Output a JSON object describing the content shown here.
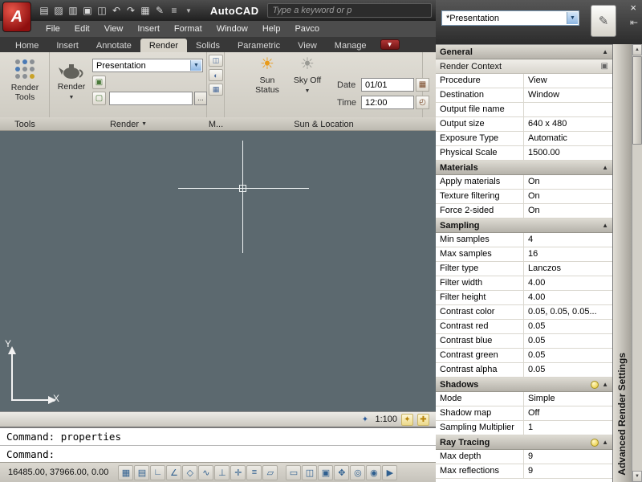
{
  "title_bar": {
    "app_name": "AutoCAD",
    "search_value": "Type a keyword or p",
    "qat_icons": [
      "new",
      "open",
      "save",
      "plot",
      "plot-preview",
      "undo",
      "redo",
      "publish",
      "markup",
      "properties"
    ]
  },
  "menu_bar": {
    "items": [
      "File",
      "Edit",
      "View",
      "Insert",
      "Format",
      "Window",
      "Help",
      "Pavco"
    ]
  },
  "ribbon": {
    "tabs": [
      {
        "label": "Home",
        "active": false
      },
      {
        "label": "Insert",
        "active": false
      },
      {
        "label": "Annotate",
        "active": false
      },
      {
        "label": "Render",
        "active": true
      },
      {
        "label": "Solids",
        "active": false
      },
      {
        "label": "Parametric",
        "active": false
      },
      {
        "label": "View",
        "active": false
      },
      {
        "label": "Manage",
        "active": false
      }
    ],
    "tools_panel": {
      "label": "Tools",
      "button_label": "Render Tools"
    },
    "render_panel": {
      "label": "Render",
      "button_label": "Render",
      "preset_value": "Presentation",
      "browse_label": "...",
      "output_file_value": ""
    },
    "materials_panel": {
      "label": "M...",
      "icons": [
        "materials-browser",
        "materials-editor",
        "planar-mapping"
      ]
    },
    "sun_panel": {
      "label": "Sun & Location",
      "sun_button": "Sun Status",
      "sky_button": "Sky Off",
      "date_label": "Date",
      "date_value": "01/01",
      "time_label": "Time",
      "time_value": "12:00"
    }
  },
  "drawing_area": {
    "ucs_x_label": "X",
    "ucs_y_label": "Y"
  },
  "scale_bar": {
    "annotation_scale": "1:100"
  },
  "command_line": {
    "line1": "Command: properties",
    "line2": "Command:"
  },
  "status_bar": {
    "coordinates": "16485.00, 37966.00, 0.00",
    "left_icons": [
      "snap",
      "grid",
      "ortho",
      "polar",
      "osnap",
      "otrack",
      "ducs",
      "dyn",
      "lwt",
      "qp"
    ],
    "right_icons": [
      "model",
      "quick-view-drawings",
      "quick-view-layouts",
      "pan",
      "zoom",
      "steering-wheel",
      "show-motion"
    ]
  },
  "palette": {
    "title": "Advanced Render Settings",
    "preset_value": "*Presentation",
    "rows": [
      {
        "type": "section",
        "label": "General",
        "bulb": false
      },
      {
        "type": "subsection",
        "label": "Render Context"
      },
      {
        "type": "row",
        "label": "Procedure",
        "value": "View"
      },
      {
        "type": "row",
        "label": "Destination",
        "value": "Window"
      },
      {
        "type": "row",
        "label": "Output file name",
        "value": ""
      },
      {
        "type": "row",
        "label": "Output size",
        "value": "640 x 480"
      },
      {
        "type": "row",
        "label": "Exposure Type",
        "value": "Automatic"
      },
      {
        "type": "row",
        "label": "Physical Scale",
        "value": "1500.00"
      },
      {
        "type": "section",
        "label": "Materials",
        "bulb": false
      },
      {
        "type": "row",
        "label": "Apply materials",
        "value": "On"
      },
      {
        "type": "row",
        "label": "Texture filtering",
        "value": "On"
      },
      {
        "type": "row",
        "label": "Force 2-sided",
        "value": "On"
      },
      {
        "type": "section",
        "label": "Sampling",
        "bulb": false
      },
      {
        "type": "row",
        "label": "Min samples",
        "value": "4"
      },
      {
        "type": "row",
        "label": "Max samples",
        "value": "16"
      },
      {
        "type": "row",
        "label": "Filter type",
        "value": "Lanczos"
      },
      {
        "type": "row",
        "label": "Filter width",
        "value": "4.00"
      },
      {
        "type": "row",
        "label": "Filter height",
        "value": "4.00"
      },
      {
        "type": "row",
        "label": "Contrast color",
        "value": "0.05, 0.05, 0.05..."
      },
      {
        "type": "row",
        "label": "Contrast red",
        "value": "0.05"
      },
      {
        "type": "row",
        "label": "Contrast blue",
        "value": "0.05"
      },
      {
        "type": "row",
        "label": "Contrast green",
        "value": "0.05"
      },
      {
        "type": "row",
        "label": "Contrast alpha",
        "value": "0.05"
      },
      {
        "type": "section",
        "label": "Shadows",
        "bulb": true
      },
      {
        "type": "row",
        "label": "Mode",
        "value": "Simple"
      },
      {
        "type": "row",
        "label": "Shadow map",
        "value": "Off"
      },
      {
        "type": "row",
        "label": "Sampling Multiplier",
        "value": "1"
      },
      {
        "type": "section",
        "label": "Ray Tracing",
        "bulb": true
      },
      {
        "type": "row",
        "label": "Max depth",
        "value": "9"
      },
      {
        "type": "row",
        "label": "Max reflections",
        "value": "9"
      }
    ]
  }
}
